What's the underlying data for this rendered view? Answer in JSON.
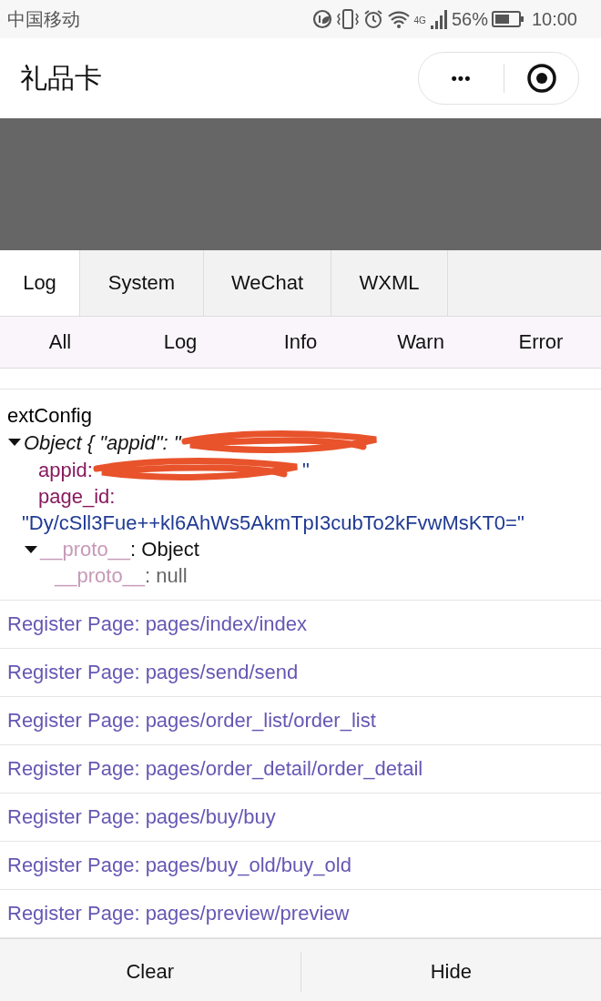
{
  "status_bar": {
    "carrier": "中国移动",
    "network": "4G",
    "battery": "56%",
    "time": "10:00"
  },
  "nav_bar": {
    "title": "礼品卡",
    "more": "•••"
  },
  "tabs": [
    {
      "label": "Log",
      "selected": true
    },
    {
      "label": "System",
      "selected": false
    },
    {
      "label": "WeChat",
      "selected": false
    },
    {
      "label": "WXML",
      "selected": false
    }
  ],
  "filters": [
    {
      "label": "All",
      "selected": false
    },
    {
      "label": "Log",
      "selected": false
    },
    {
      "label": "Info",
      "selected": false
    },
    {
      "label": "Warn",
      "selected": false
    },
    {
      "label": "Error",
      "selected": false
    }
  ],
  "ext_config": {
    "title": "extConfig",
    "summary": "Object { \"appid\": \"",
    "appid_key": "appid:",
    "appid_close": "\"",
    "page_id_key": "page_id:",
    "page_id_value": "\"Dy/cSll3Fue++kl6AhWs5AkmTpI3cubTo2kFvwMsKT0=\"",
    "proto_key": "__proto__",
    "proto_value": ": Object",
    "proto2_key": "__proto__",
    "proto2_value": ": null"
  },
  "logs": [
    "Register Page: pages/index/index",
    "Register Page: pages/send/send",
    "Register Page: pages/order_list/order_list",
    "Register Page: pages/order_detail/order_detail",
    "Register Page: pages/buy/buy",
    "Register Page: pages/buy_old/buy_old",
    "Register Page: pages/preview/preview"
  ],
  "buttons": [
    "Clear",
    "Hide"
  ]
}
